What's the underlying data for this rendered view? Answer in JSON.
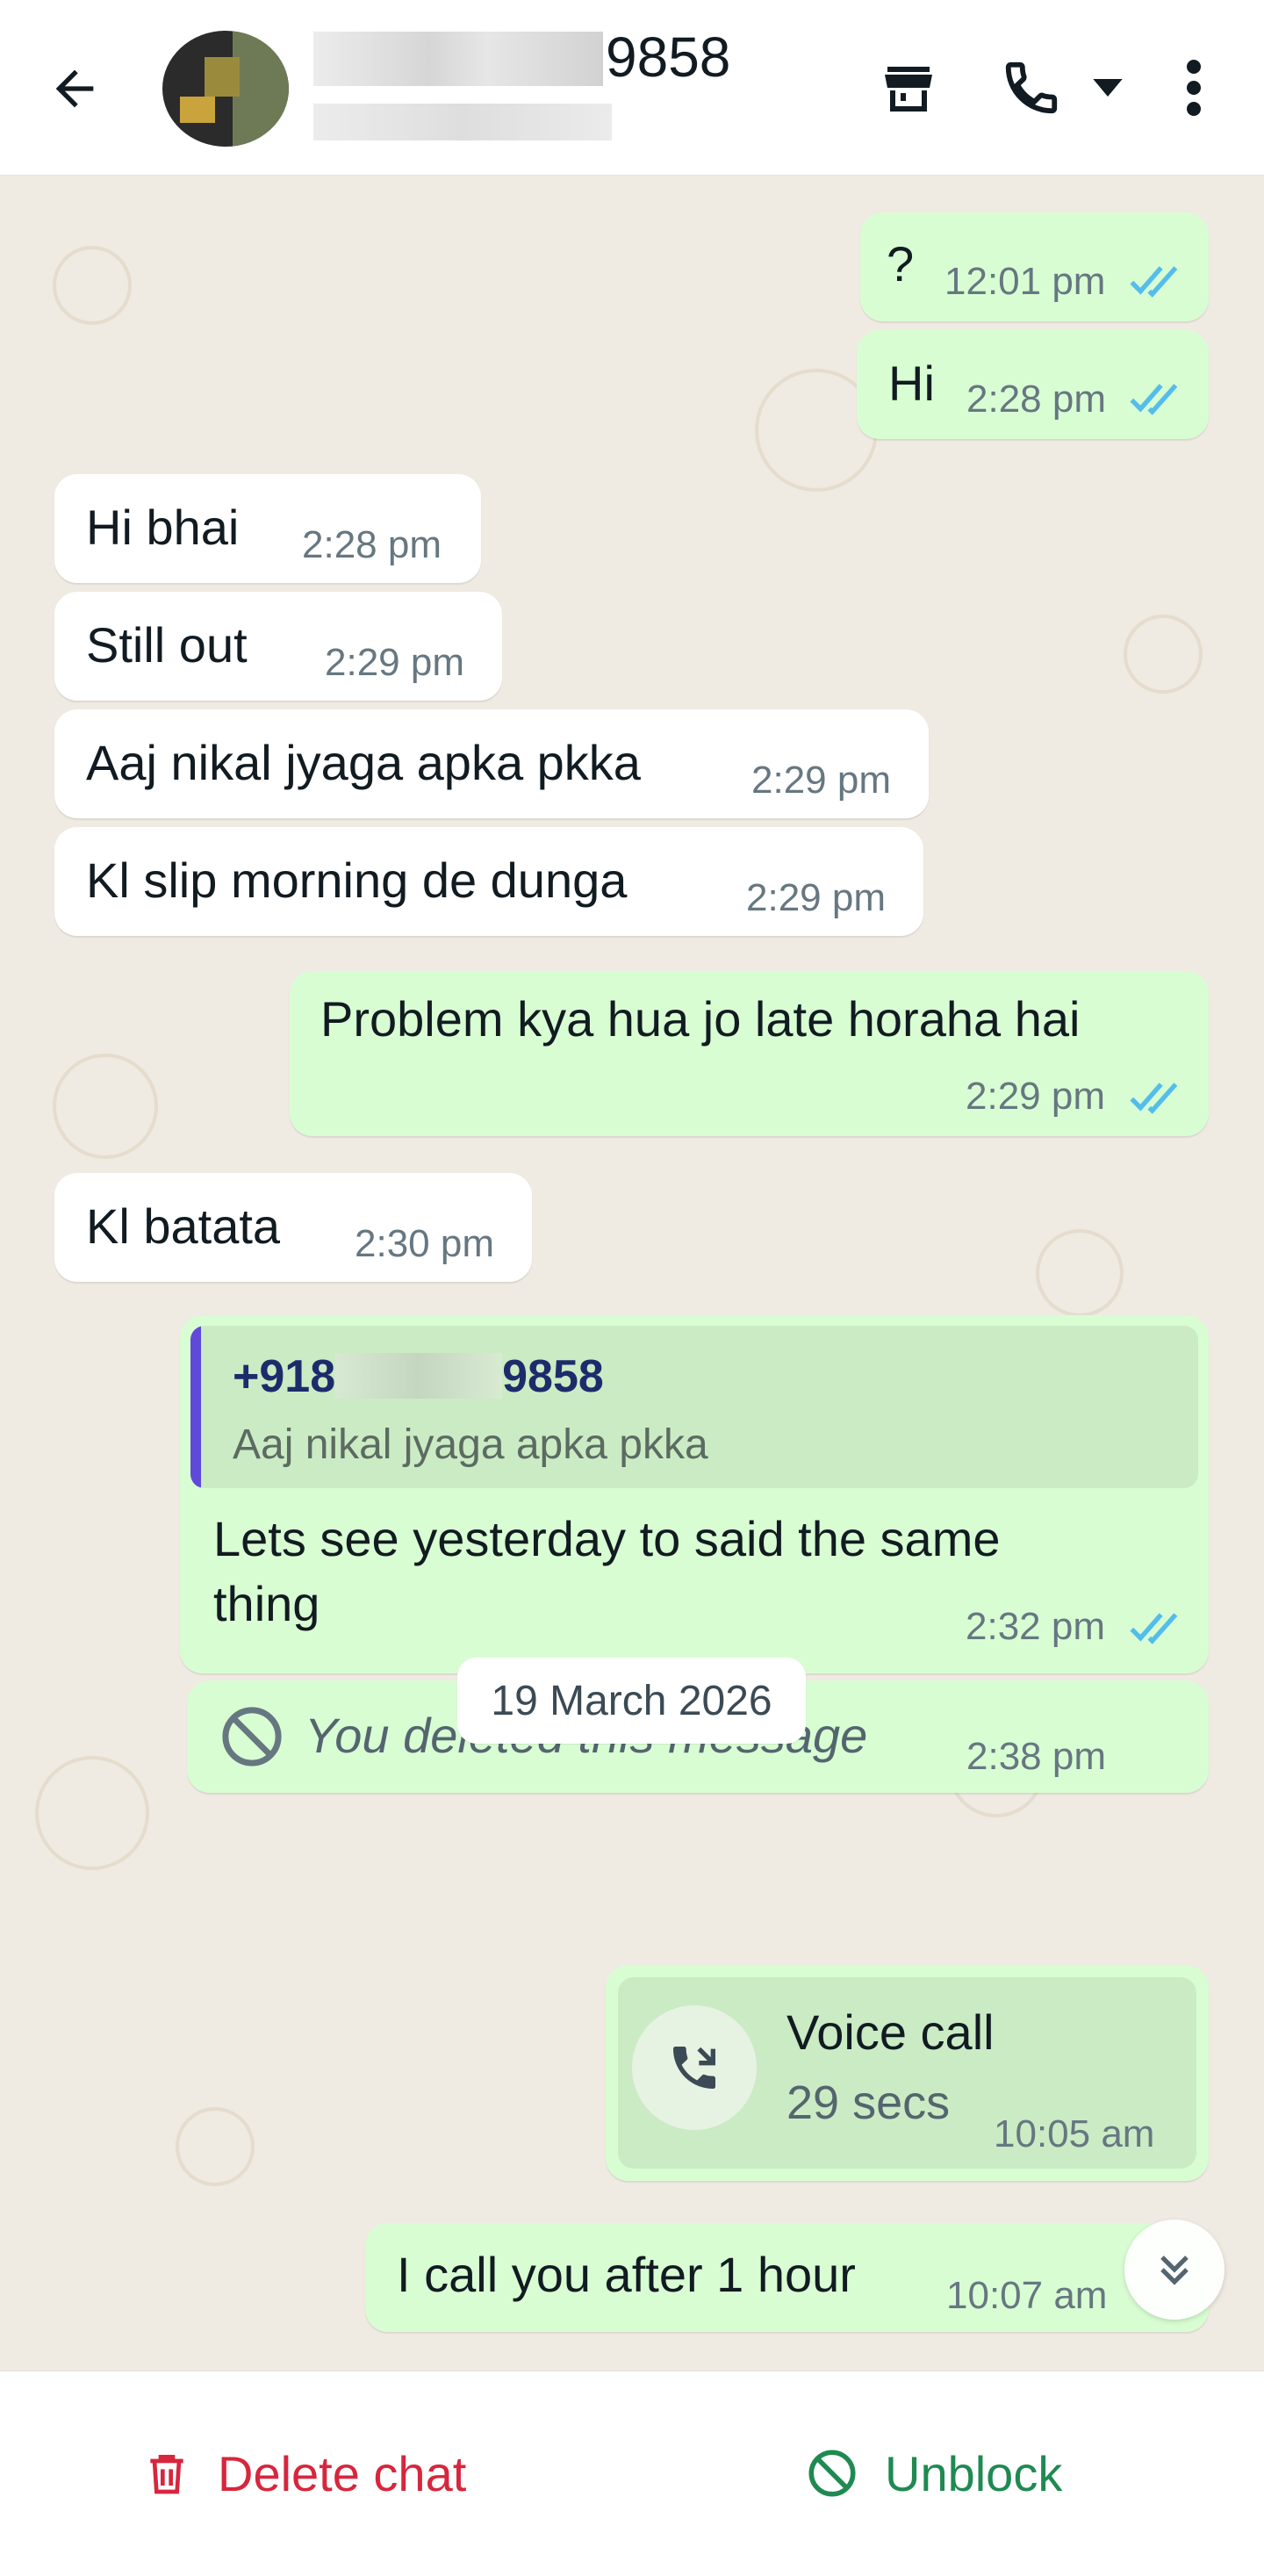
{
  "header": {
    "contact_name_visible": "9858",
    "colors": {
      "header_bg": "#ffffff",
      "icon": "#111b21"
    }
  },
  "messages": {
    "m1": {
      "text": "?",
      "time": "12:01 pm"
    },
    "m2": {
      "text": "Hi",
      "time": "2:28 pm"
    },
    "m3": {
      "text": "Hi bhai",
      "time": "2:28 pm"
    },
    "m4": {
      "text": "Still out",
      "time": "2:29 pm"
    },
    "m5": {
      "text": "Aaj nikal jyaga apka pkka",
      "time": "2:29 pm"
    },
    "m6": {
      "text": "Kl slip morning de dunga",
      "time": "2:29 pm"
    },
    "m7": {
      "text": "Problem kya hua jo late horaha hai",
      "time": "2:29 pm"
    },
    "m8": {
      "text": "Kl batata",
      "time": "2:30 pm"
    },
    "m9": {
      "quote_sender_prefix": "+918",
      "quote_sender_suffix": "9858",
      "quote_text": "Aaj nikal jyaga apka pkka",
      "line1": "Lets see yesterday to said the same",
      "line2": "thing",
      "time": "2:32 pm"
    },
    "m10": {
      "text": "You deleted this message",
      "time": "2:38 pm"
    },
    "date_separator": "19 March 2026",
    "m11": {
      "title": "Voice call",
      "duration": "29 secs",
      "time": "10:05 am"
    },
    "m12": {
      "text": "I call you after 1 hour",
      "time": "10:07 am"
    }
  },
  "footer": {
    "delete_label": "Delete chat",
    "unblock_label": "Unblock",
    "delete_color": "#d7263d",
    "unblock_color": "#1f8a52"
  },
  "icons": [
    "back-arrow-icon",
    "shop-icon",
    "call-icon",
    "dropdown-icon",
    "more-options-icon",
    "read-receipt-icon",
    "deleted-icon",
    "missed-call-icon",
    "scroll-down-icon",
    "trash-icon",
    "unblock-icon"
  ]
}
